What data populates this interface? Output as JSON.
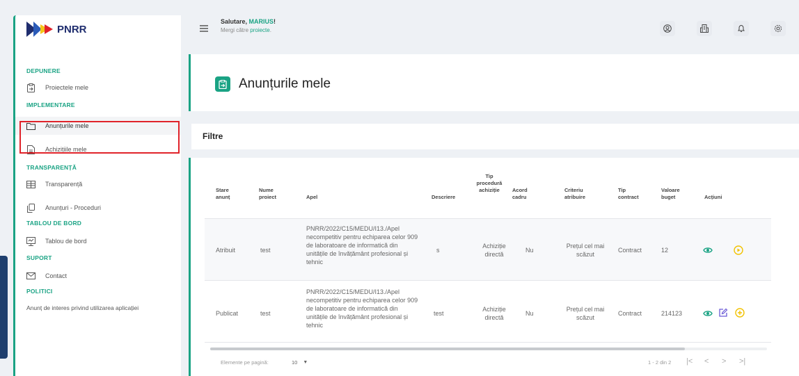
{
  "brand": {
    "name": "PNRR"
  },
  "header": {
    "greeting": "Salutare,",
    "user": "MARIUS",
    "exclaim": "!",
    "sub_prefix": "Mergi către",
    "sub_link": "proiecte",
    "sub_suffix": "."
  },
  "sidebar": {
    "sections": [
      {
        "title": "DEPUNERE",
        "items": [
          {
            "label": "Proiectele mele",
            "icon": "clipboard-icon"
          }
        ]
      },
      {
        "title": "IMPLEMENTARE",
        "items": [
          {
            "label": "Anunțurile mele",
            "icon": "folder-icon"
          },
          {
            "label": "Achizițiile mele",
            "icon": "document-icon"
          }
        ]
      },
      {
        "title": "TRANSPARENȚĂ",
        "items": [
          {
            "label": "Transparență",
            "icon": "table-icon"
          },
          {
            "label": "Anunțuri - Proceduri",
            "icon": "copy-icon"
          }
        ]
      },
      {
        "title": "TABLOU DE BORD",
        "items": [
          {
            "label": "Tablou de bord",
            "icon": "presentation-icon"
          }
        ]
      },
      {
        "title": "SUPORT",
        "items": [
          {
            "label": "Contact",
            "icon": "mail-icon"
          }
        ]
      },
      {
        "title": "POLITICI",
        "items": [
          {
            "label": "Anunț de interes privind utilizarea aplicației",
            "icon": ""
          }
        ]
      }
    ]
  },
  "page": {
    "title": "Anunțurile mele",
    "filters_label": "Filtre"
  },
  "table": {
    "columns": [
      "Stare anunț",
      "Nume proiect",
      "Apel",
      "Descriere",
      "Tip procedură achiziție",
      "Acord cadru",
      "Criteriu atribuire",
      "Tip contract",
      "Valoare buget",
      "Acțiuni"
    ],
    "rows": [
      {
        "stare": "Atribuit",
        "nume": "test",
        "apel": "PNRR/2022/C15/MEDU/I13./Apel necompetitiv pentru echiparea celor 909 de laboratoare de informatică din unitățile de învățământ profesional și tehnic",
        "descriere": "s",
        "tip_procedura": "Achiziție directă",
        "acord": "Nu",
        "criteriu": "Prețul cel mai scăzut",
        "tip_contract": "Contract",
        "valoare": "12"
      },
      {
        "stare": "Publicat",
        "nume": "test",
        "apel": "PNRR/2022/C15/MEDU/I13./Apel necompetitiv pentru echiparea celor 909 de laboratoare de informatică din unitățile de învățământ profesional și tehnic",
        "descriere": "test",
        "tip_procedura": "Achiziție directă",
        "acord": "Nu",
        "criteriu": "Prețul cel mai scăzut",
        "tip_contract": "Contract",
        "valoare": "214123"
      }
    ]
  },
  "pagination": {
    "per_page_label": "Elemente pe pagină:",
    "per_page_value": "10",
    "range": "1 - 2 din 2",
    "first": "|<",
    "prev": "<",
    "next": ">",
    "last": ">|"
  },
  "colors": {
    "accent": "#1aa384",
    "highlight": "#e0232a",
    "brand_navy": "#1f2d6e",
    "brand_yellow": "#f5c518",
    "action_yellow": "#f2c200",
    "action_purple": "#6b5bd6"
  }
}
